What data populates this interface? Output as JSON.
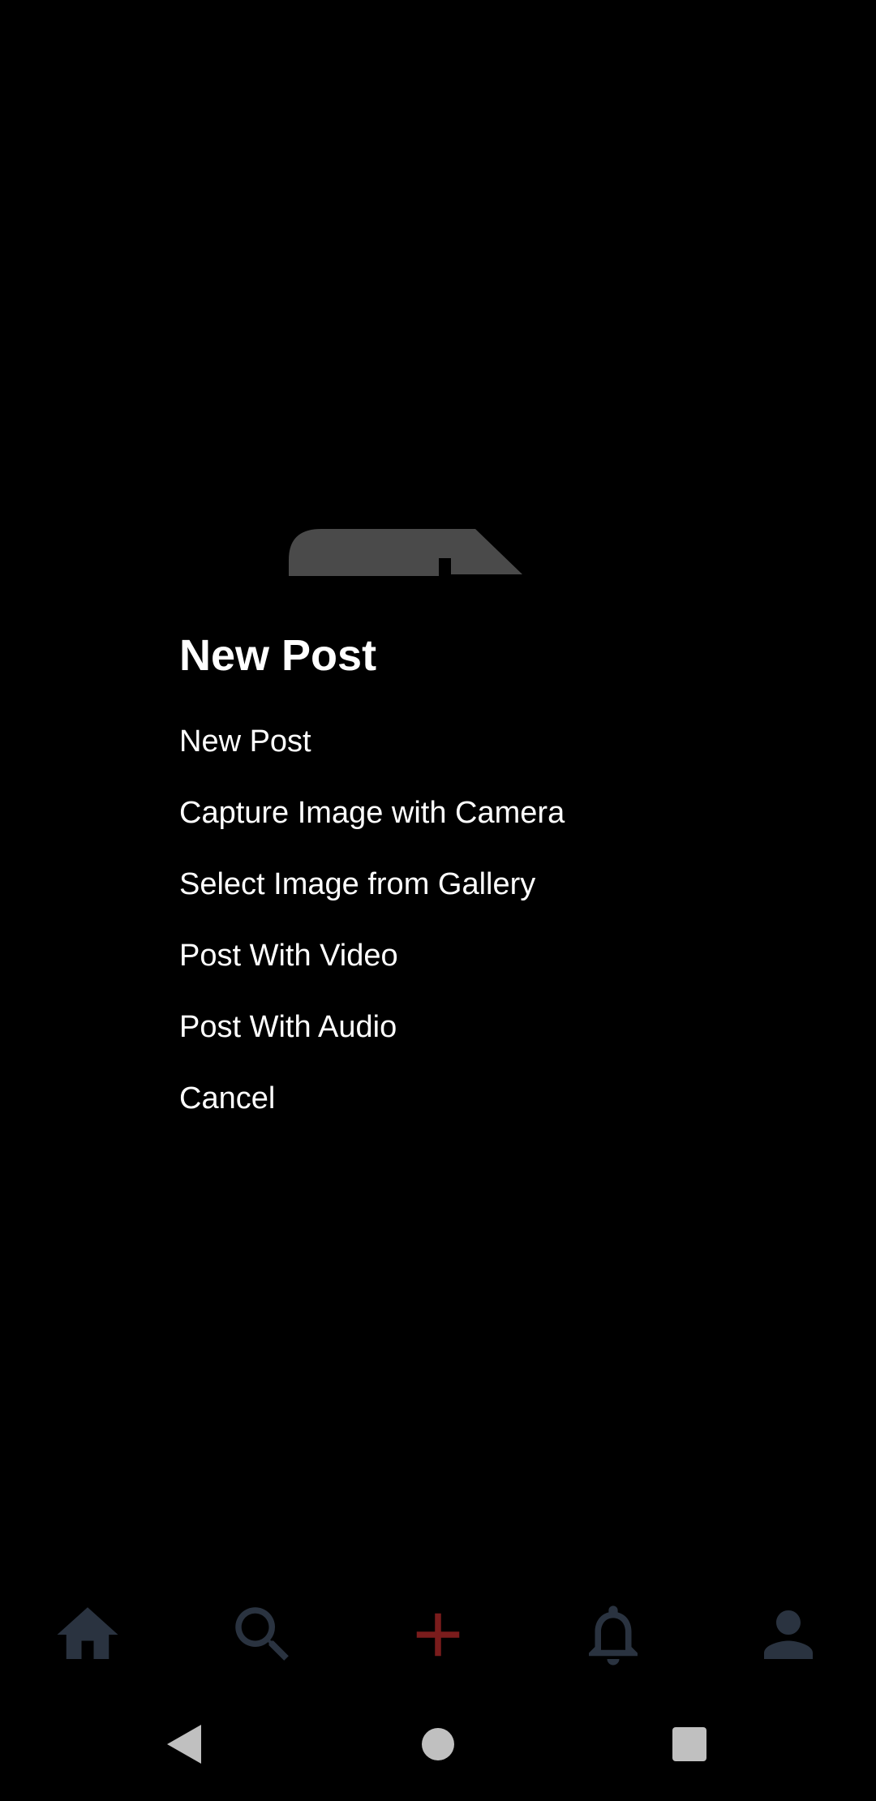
{
  "dialog": {
    "title": "New Post",
    "items": [
      "New Post",
      "Capture Image with Camera",
      "Select Image from Gallery",
      "Post With Video",
      "Post With Audio",
      "Cancel"
    ]
  },
  "bottom_nav": {
    "icons": [
      "home-icon",
      "search-icon",
      "plus-icon",
      "bell-icon",
      "person-icon"
    ],
    "icon_color": "#2a3340",
    "active_color": "#7a1c1c"
  },
  "system_nav": {
    "icons": [
      "back-icon",
      "home-circle-icon",
      "recents-icon"
    ],
    "color": "#c0c0c0"
  },
  "colors": {
    "background": "#000000",
    "text": "#ffffff",
    "shape": "#4a4a4a"
  }
}
